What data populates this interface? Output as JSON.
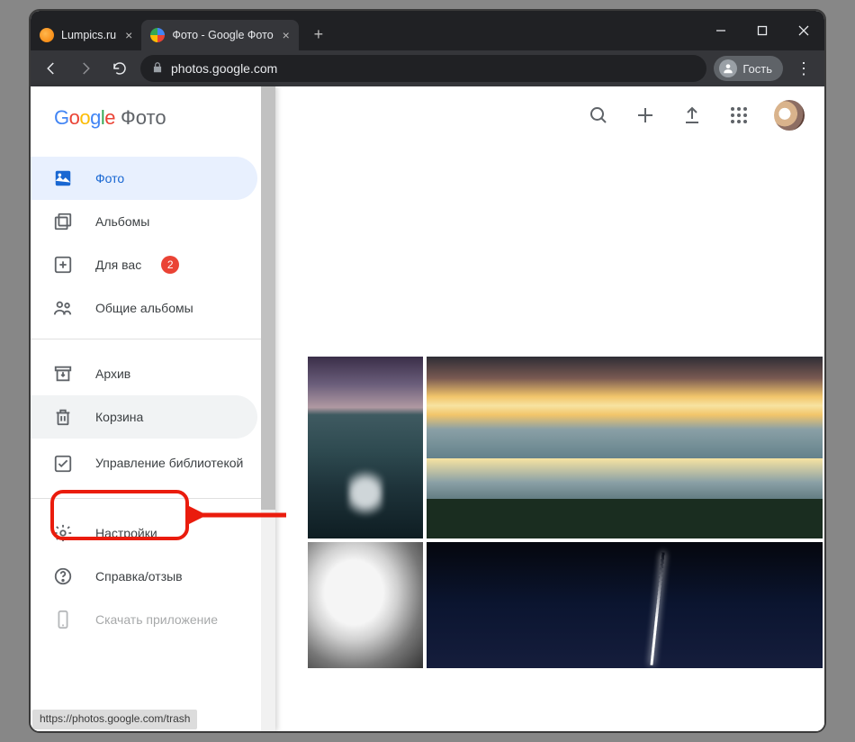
{
  "browser": {
    "tabs": [
      {
        "label": "Lumpics.ru",
        "active": false
      },
      {
        "label": "Фото - Google Фото",
        "active": true
      }
    ],
    "url": "photos.google.com",
    "guest_label": "Гость",
    "status_url": "https://photos.google.com/trash"
  },
  "brand": {
    "product": "Фото"
  },
  "sidebar": {
    "items": [
      {
        "label": "Фото",
        "icon": "photo-icon",
        "active": true
      },
      {
        "label": "Альбомы",
        "icon": "albums-icon"
      },
      {
        "label": "Для вас",
        "icon": "for-you-icon",
        "badge": "2"
      },
      {
        "label": "Общие альбомы",
        "icon": "shared-icon"
      }
    ],
    "secondary": [
      {
        "label": "Архив",
        "icon": "archive-icon"
      },
      {
        "label": "Корзина",
        "icon": "trash-icon"
      },
      {
        "label": "Управление библиотекой",
        "icon": "manage-icon",
        "twoline": true
      }
    ],
    "tertiary": [
      {
        "label": "Настройки",
        "icon": "settings-icon"
      },
      {
        "label": "Справка/отзыв",
        "icon": "help-icon"
      },
      {
        "label": "Скачать приложение",
        "icon": "download-icon"
      }
    ]
  }
}
